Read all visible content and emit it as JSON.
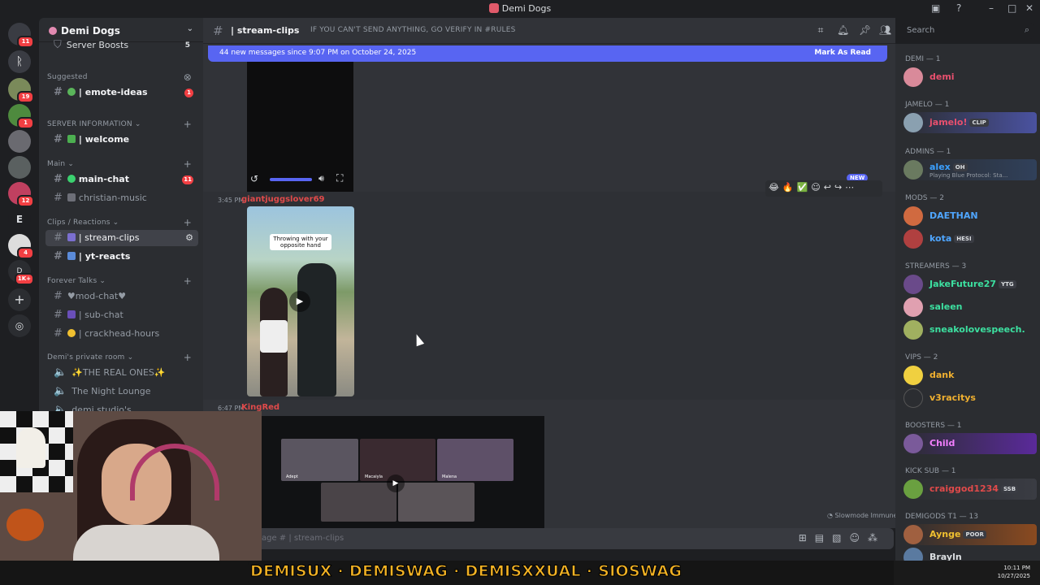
{
  "window": {
    "title": "Demi Dogs"
  },
  "server": {
    "name": "Demi Dogs"
  },
  "sidebar": {
    "boosts": {
      "label": "Server Boosts",
      "count": "5"
    },
    "suggested": {
      "label": "Suggested",
      "channel": "| emote-ideas",
      "badge": "1"
    },
    "categories": [
      {
        "label": "SERVER INFORMATION",
        "channels": [
          {
            "label": "| welcome"
          }
        ]
      },
      {
        "label": "Main",
        "channels": [
          {
            "label": "main-chat",
            "badge": "11"
          },
          {
            "label": "christian-music"
          }
        ]
      },
      {
        "label": "Clips / Reactions",
        "channels": [
          {
            "label": "| stream-clips"
          },
          {
            "label": "| yt-reacts"
          }
        ]
      },
      {
        "label": "Forever Talks",
        "channels": [
          {
            "label": "♥︎mod-chat♥︎"
          },
          {
            "label": "| sub-chat"
          },
          {
            "label": "| crackhead-hours"
          }
        ]
      },
      {
        "label": "Demi's private room",
        "channels": [
          {
            "label": "✨THE REAL ONES✨"
          },
          {
            "label": "The Night Lounge"
          },
          {
            "label": "demi studio's"
          }
        ]
      }
    ]
  },
  "rail": {
    "badges": [
      "11",
      "19",
      "1",
      "12",
      "4",
      "1K+"
    ],
    "letters": [
      "E",
      "D"
    ]
  },
  "header": {
    "channel": "| stream-clips",
    "topic": "IF YOU CAN'T SEND ANYTHING, GO VERIFY IN #RULES"
  },
  "search": {
    "placeholder": "Search"
  },
  "newbar": {
    "text": "44 new messages since 9:07 PM on October 24, 2025",
    "action": "Mark As Read"
  },
  "toolbar": {
    "new_label": "NEW"
  },
  "messages": [
    {
      "time": "3:45 PM",
      "author": "giantjuggslover69",
      "caption": "Throwing with your opposite hand"
    },
    {
      "time": "6:47 PM",
      "author": "KingRed"
    }
  ],
  "video_tiles": [
    "Adept",
    "Macaiyla",
    "Malena"
  ],
  "input": {
    "placeholder": "age # | stream-clips",
    "slowmode": "Slowmode Immune"
  },
  "members": {
    "groups": [
      {
        "label": "DEMI — 1",
        "members": [
          {
            "name": "demi",
            "color": "#e8506e"
          }
        ]
      },
      {
        "label": "JAMELO — 1",
        "members": [
          {
            "name": "jamelo!",
            "color": "#e8506e",
            "tag": "CLIP"
          }
        ]
      },
      {
        "label": "ADMINS — 1",
        "members": [
          {
            "name": "alex",
            "color": "#3ba0ff",
            "tag": "OH",
            "status": "Playing Blue Protocol: Sta..."
          }
        ]
      },
      {
        "label": "MODS — 2",
        "members": [
          {
            "name": "DAETHAN",
            "color": "#4fa6ff"
          },
          {
            "name": "kota",
            "color": "#4fa6ff",
            "tag": "HESI"
          }
        ]
      },
      {
        "label": "STREAMERS — 3",
        "members": [
          {
            "name": "JakeFuture27",
            "color": "#3ce0a0",
            "tag": "YTG"
          },
          {
            "name": "saleen",
            "color": "#3ce0a0"
          },
          {
            "name": "sneakolovespeech.",
            "color": "#3ce0a0"
          }
        ]
      },
      {
        "label": "VIPS — 2",
        "members": [
          {
            "name": "dank",
            "color": "#f0b030"
          },
          {
            "name": "v3racitys",
            "color": "#f0b030"
          }
        ]
      },
      {
        "label": "BOOSTERS — 1",
        "members": [
          {
            "name": "Child",
            "color": "#f47fff"
          }
        ]
      },
      {
        "label": "KICK SUB — 1",
        "members": [
          {
            "name": "craiggod1234",
            "color": "#e04a4a",
            "tag": "SSB"
          }
        ]
      },
      {
        "label": "DEMIGODS T1 — 13",
        "members": [
          {
            "name": "Aynge",
            "color": "#f0c030",
            "tag": "POOR"
          },
          {
            "name": "Brayln",
            "color": "#dbdee1"
          }
        ]
      }
    ]
  },
  "overlay": {
    "banner": "DEMISUX · DEMISWAG · DEMISXXUAL · SIOSWAG"
  },
  "taskbar": {
    "time": "10:11 PM",
    "date": "10/27/2025"
  },
  "colors": {
    "accent": "#5865f2",
    "danger": "#f23f43",
    "bg": "#313338",
    "sidebar": "#2b2d31"
  }
}
